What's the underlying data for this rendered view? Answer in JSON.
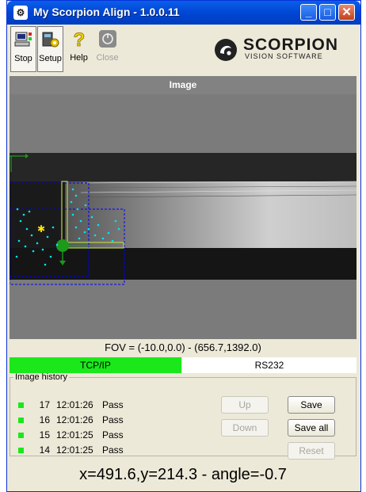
{
  "window": {
    "title": "My Scorpion Align - 1.0.0.11"
  },
  "toolbar": {
    "stop_label": "Stop",
    "setup_label": "Setup",
    "help_label": "Help",
    "close_label": "Close"
  },
  "brand": {
    "name": "SCORPION",
    "tagline": "VISION SOFTWARE"
  },
  "panel": {
    "title": "Image"
  },
  "fov": "FOV = (-10.0,0.0) - (656.7,1392.0)",
  "status": {
    "tcpip": "TCP/IP",
    "rs232": "RS232"
  },
  "history": {
    "legend": "Image history",
    "rows": [
      {
        "num": "17",
        "time": "12:01:26",
        "result": "Pass"
      },
      {
        "num": "16",
        "time": "12:01:26",
        "result": "Pass"
      },
      {
        "num": "15",
        "time": "12:01:25",
        "result": "Pass"
      },
      {
        "num": "14",
        "time": "12:01:25",
        "result": "Pass"
      }
    ],
    "buttons": {
      "up": "Up",
      "down": "Down",
      "save": "Save",
      "save_all": "Save all",
      "reset": "Reset"
    }
  },
  "result": "x=491.6,y=214.3 - angle=-0.7",
  "colors": {
    "pass": "#1BE81B",
    "overlay_blue": "#0000FF",
    "overlay_cyan": "#00E5FF",
    "overlay_green": "#1C9A1C"
  }
}
